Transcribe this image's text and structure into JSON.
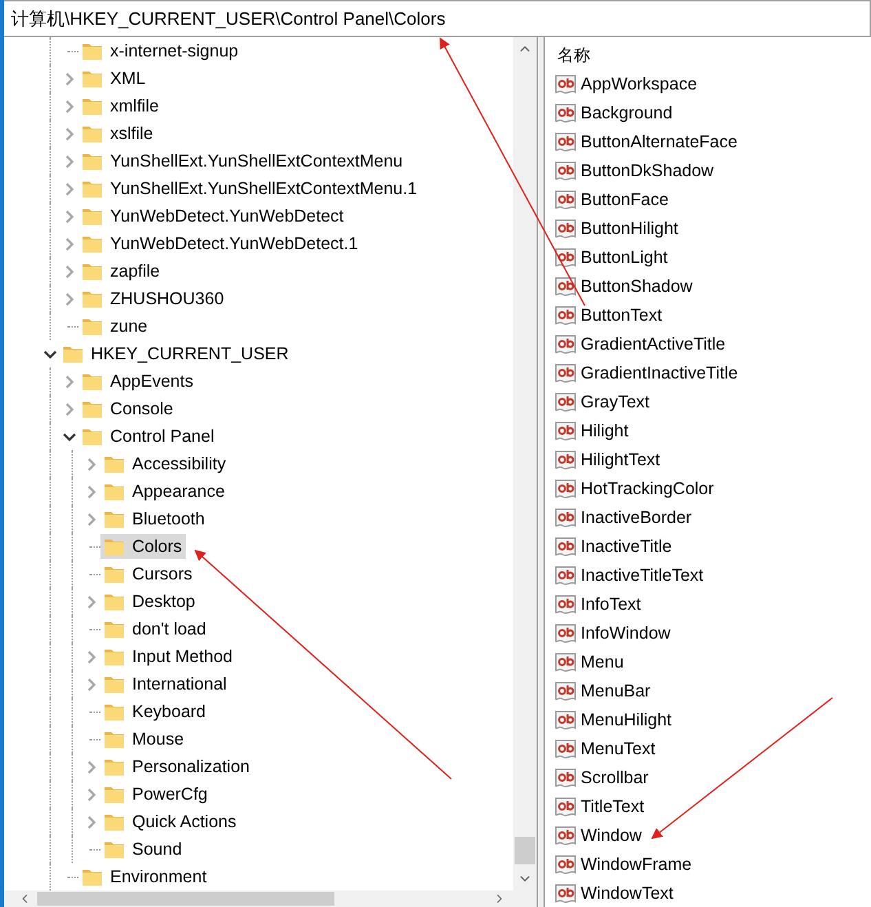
{
  "address": "计算机\\HKEY_CURRENT_USER\\Control Panel\\Colors",
  "tree": {
    "continued_items": [
      {
        "label": "x-internet-signup",
        "expandable": false,
        "selected": false
      },
      {
        "label": "XML",
        "expandable": true,
        "expanded": false,
        "selected": false
      },
      {
        "label": "xmlfile",
        "expandable": true,
        "expanded": false,
        "selected": false
      },
      {
        "label": "xslfile",
        "expandable": true,
        "expanded": false,
        "selected": false
      },
      {
        "label": "YunShellExt.YunShellExtContextMenu",
        "expandable": true,
        "expanded": false,
        "selected": false
      },
      {
        "label": "YunShellExt.YunShellExtContextMenu.1",
        "expandable": true,
        "expanded": false,
        "selected": false
      },
      {
        "label": "YunWebDetect.YunWebDetect",
        "expandable": true,
        "expanded": false,
        "selected": false
      },
      {
        "label": "YunWebDetect.YunWebDetect.1",
        "expandable": true,
        "expanded": false,
        "selected": false
      },
      {
        "label": "zapfile",
        "expandable": true,
        "expanded": false,
        "selected": false
      },
      {
        "label": "ZHUSHOU360",
        "expandable": true,
        "expanded": false,
        "selected": false
      },
      {
        "label": "zune",
        "expandable": false,
        "selected": false
      }
    ],
    "items": [
      {
        "label": "HKEY_CURRENT_USER",
        "expandable": true,
        "expanded": true,
        "selected": false,
        "children": [
          {
            "label": "AppEvents",
            "expandable": true,
            "expanded": false,
            "selected": false
          },
          {
            "label": "Console",
            "expandable": true,
            "expanded": false,
            "selected": false
          },
          {
            "label": "Control Panel",
            "expandable": true,
            "expanded": true,
            "selected": false,
            "children": [
              {
                "label": "Accessibility",
                "expandable": true,
                "expanded": false,
                "selected": false
              },
              {
                "label": "Appearance",
                "expandable": true,
                "expanded": false,
                "selected": false
              },
              {
                "label": "Bluetooth",
                "expandable": true,
                "expanded": false,
                "selected": false
              },
              {
                "label": "Colors",
                "expandable": false,
                "selected": true
              },
              {
                "label": "Cursors",
                "expandable": false,
                "selected": false
              },
              {
                "label": "Desktop",
                "expandable": true,
                "expanded": false,
                "selected": false
              },
              {
                "label": "don't load",
                "expandable": false,
                "selected": false
              },
              {
                "label": "Input Method",
                "expandable": true,
                "expanded": false,
                "selected": false
              },
              {
                "label": "International",
                "expandable": true,
                "expanded": false,
                "selected": false
              },
              {
                "label": "Keyboard",
                "expandable": false,
                "selected": false
              },
              {
                "label": "Mouse",
                "expandable": false,
                "selected": false
              },
              {
                "label": "Personalization",
                "expandable": true,
                "expanded": false,
                "selected": false
              },
              {
                "label": "PowerCfg",
                "expandable": true,
                "expanded": false,
                "selected": false
              },
              {
                "label": "Quick Actions",
                "expandable": true,
                "expanded": false,
                "selected": false
              },
              {
                "label": "Sound",
                "expandable": false,
                "selected": false
              }
            ]
          },
          {
            "label": "Environment",
            "expandable": false,
            "selected": false
          }
        ]
      }
    ]
  },
  "values": {
    "column_header": "名称",
    "items": [
      "AppWorkspace",
      "Background",
      "ButtonAlternateFace",
      "ButtonDkShadow",
      "ButtonFace",
      "ButtonHilight",
      "ButtonLight",
      "ButtonShadow",
      "ButtonText",
      "GradientActiveTitle",
      "GradientInactiveTitle",
      "GrayText",
      "Hilight",
      "HilightText",
      "HotTrackingColor",
      "InactiveBorder",
      "InactiveTitle",
      "InactiveTitleText",
      "InfoText",
      "InfoWindow",
      "Menu",
      "MenuBar",
      "MenuHilight",
      "MenuText",
      "Scrollbar",
      "TitleText",
      "Window",
      "WindowFrame",
      "WindowText"
    ]
  }
}
